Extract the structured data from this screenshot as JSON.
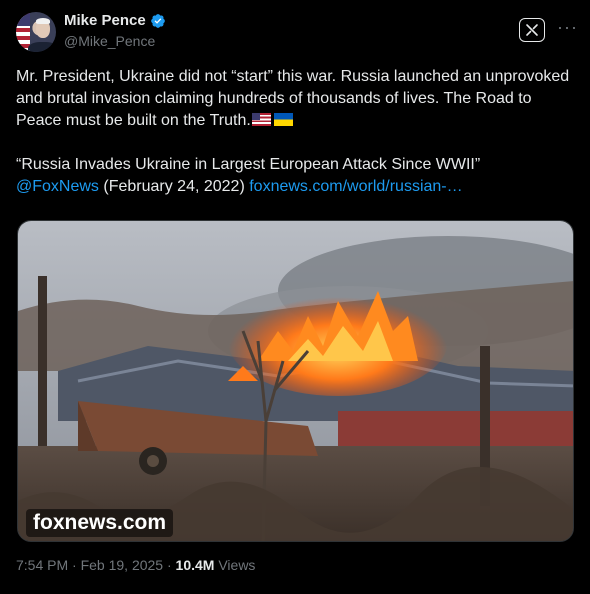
{
  "author": {
    "name": "Mike Pence",
    "handle": "@Mike_Pence"
  },
  "tweet": {
    "line1": "Mr. President, Ukraine did not “start” this war. Russia launched an unprovoked and brutal invasion claiming hundreds of thousands of lives. The Road to Peace must be built on the Truth.",
    "quote_title": "“Russia Invades Ukraine in Largest European Attack Since WWII”",
    "mention": "@FoxNews",
    "date_text": " (February 24, 2022) ",
    "url": "foxnews.com/world/russian-…",
    "media_caption": "foxnews.com"
  },
  "meta": {
    "time": "7:54 PM · Feb 19, 2025 · ",
    "views_count": "10.4M",
    "views_label": " Views"
  },
  "icons": {
    "verified": "verified-badge-icon",
    "grok": "grok-icon",
    "more": "more-icon"
  },
  "colors": {
    "background": "#000000",
    "text": "#e7e9ea",
    "secondary": "#71767b",
    "link": "#1d9bf0"
  }
}
